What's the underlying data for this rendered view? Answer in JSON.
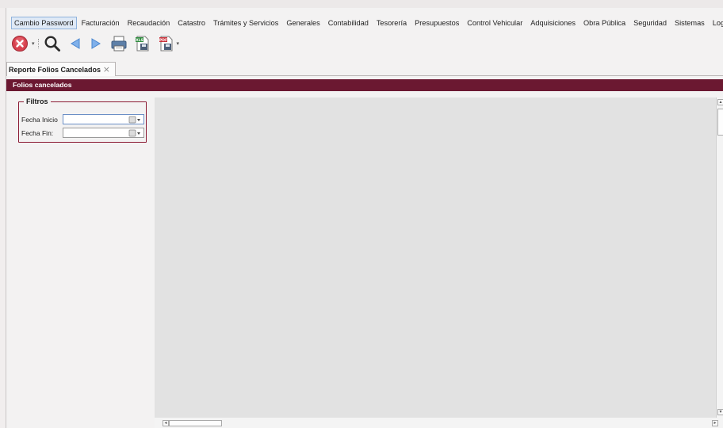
{
  "menubar": {
    "items": [
      {
        "label": "Cambio Password",
        "active": true
      },
      {
        "label": "Facturación"
      },
      {
        "label": "Recaudación"
      },
      {
        "label": "Catastro"
      },
      {
        "label": "Trámites y Servicios"
      },
      {
        "label": "Generales"
      },
      {
        "label": "Contabilidad"
      },
      {
        "label": "Tesorería"
      },
      {
        "label": "Presupuestos"
      },
      {
        "label": "Control Vehicular"
      },
      {
        "label": "Adquisiciones"
      },
      {
        "label": "Obra Pública"
      },
      {
        "label": "Seguridad"
      },
      {
        "label": "Sistemas"
      },
      {
        "label": "Log"
      }
    ]
  },
  "toolbar": {
    "icons": [
      "close-icon",
      "search-icon",
      "back-arrow-icon",
      "forward-arrow-icon",
      "print-icon",
      "export-excel-icon",
      "export-pdf-icon"
    ],
    "excel_badge": "XLS",
    "pdf_badge": "PDF"
  },
  "tab": {
    "label": "Reporte  Folios Cancelados",
    "close_glyph": "×"
  },
  "title_bar": {
    "label": "Folios cancelados"
  },
  "filters": {
    "legend": "Filtros",
    "fecha_inicio": {
      "label": "Fecha Inicio",
      "value": ""
    },
    "fecha_fin": {
      "label": "Fecha Fin:",
      "value": ""
    }
  },
  "colors": {
    "accent": "#6b1831",
    "filter_border": "#8b1a33",
    "report_bg": "#e2e2e2",
    "active_menu": "#dfe9f6"
  }
}
